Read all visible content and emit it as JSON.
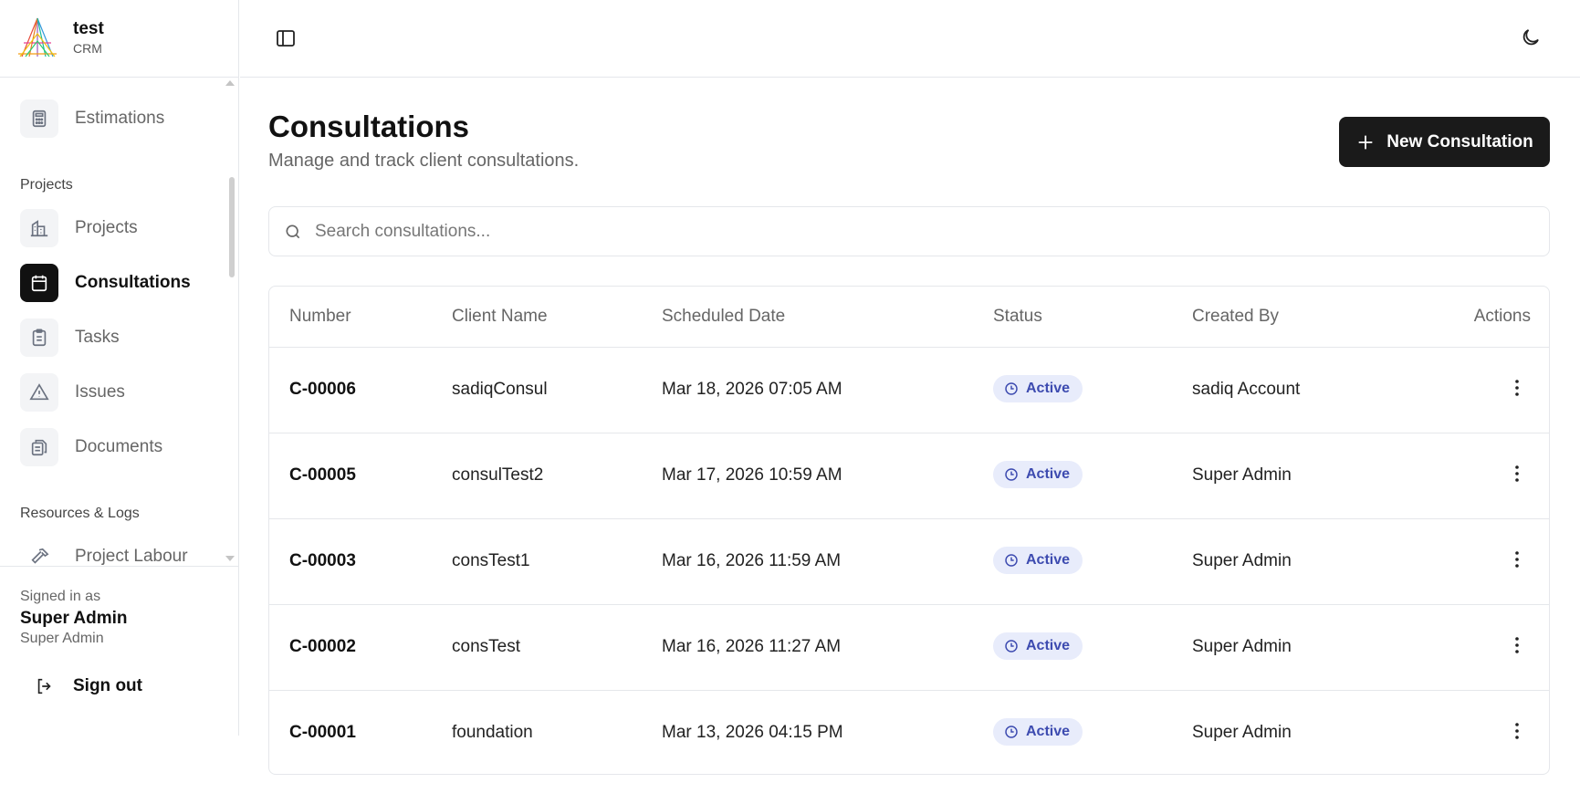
{
  "brand": {
    "name": "test",
    "sub": "CRM"
  },
  "sidebar": {
    "items": [
      {
        "label": "Estimations",
        "icon": "calculator-icon"
      },
      {
        "section": "Projects"
      },
      {
        "label": "Projects",
        "icon": "building-icon"
      },
      {
        "label": "Consultations",
        "icon": "calendar-icon",
        "active": true
      },
      {
        "label": "Tasks",
        "icon": "clipboard-icon"
      },
      {
        "label": "Issues",
        "icon": "alert-triangle-icon"
      },
      {
        "label": "Documents",
        "icon": "files-icon"
      },
      {
        "section": "Resources & Logs"
      },
      {
        "label": "Project Labour",
        "icon": "hammer-icon"
      }
    ]
  },
  "user": {
    "signed_in_label": "Signed in as",
    "name": "Super Admin",
    "role": "Super Admin",
    "sign_out": "Sign out"
  },
  "header": {
    "title": "Consultations",
    "subtitle": "Manage and track client consultations.",
    "new_button": "New Consultation"
  },
  "search": {
    "placeholder": "Search consultations..."
  },
  "table": {
    "columns": [
      "Number",
      "Client Name",
      "Scheduled Date",
      "Status",
      "Created By",
      "Actions"
    ],
    "rows": [
      {
        "number": "C-00006",
        "client": "sadiqConsul",
        "date": "Mar 18, 2026 07:05 AM",
        "status": "Active",
        "created_by": "sadiq Account"
      },
      {
        "number": "C-00005",
        "client": "consulTest2",
        "date": "Mar 17, 2026 10:59 AM",
        "status": "Active",
        "created_by": "Super Admin"
      },
      {
        "number": "C-00003",
        "client": "consTest1",
        "date": "Mar 16, 2026 11:59 AM",
        "status": "Active",
        "created_by": "Super Admin"
      },
      {
        "number": "C-00002",
        "client": "consTest",
        "date": "Mar 16, 2026 11:27 AM",
        "status": "Active",
        "created_by": "Super Admin"
      },
      {
        "number": "C-00001",
        "client": "foundation",
        "date": "Mar 13, 2026 04:15 PM",
        "status": "Active",
        "created_by": "Super Admin"
      }
    ]
  },
  "colors": {
    "accent": "#1a1a1a",
    "badge_bg": "#e8ecfb",
    "badge_text": "#3d4bb0"
  }
}
